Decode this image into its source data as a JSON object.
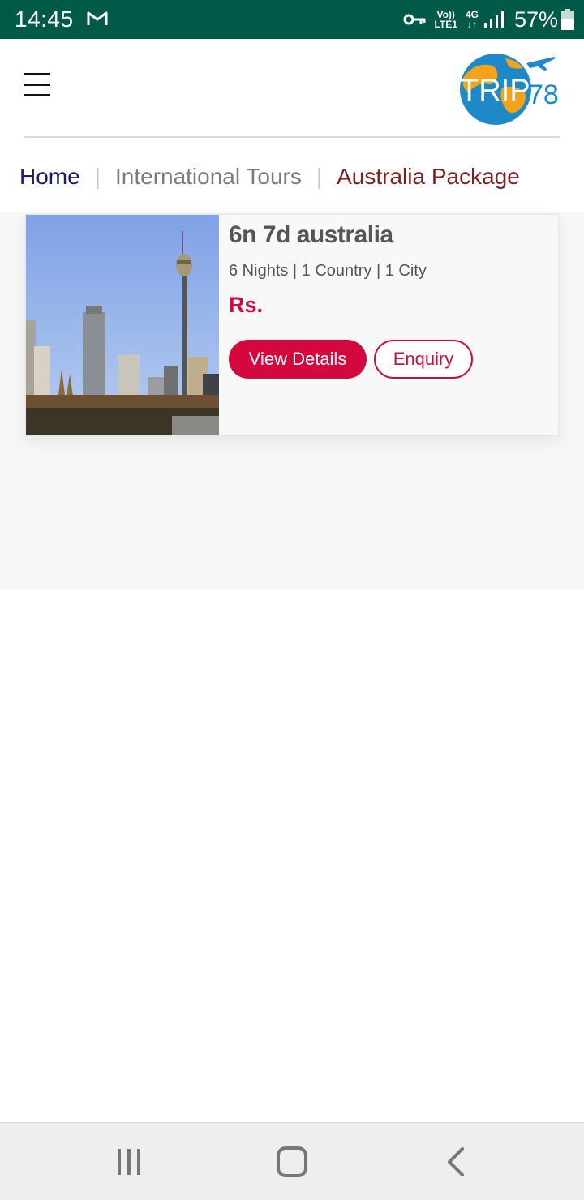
{
  "status_bar": {
    "time": "14:45",
    "volte_top": "Vo))",
    "volte_bottom": "LTE1",
    "network_top": "4G",
    "network_bottom": "↓↑",
    "battery_percent": "57%",
    "icons": [
      "gmail-icon",
      "vpn-key-icon",
      "signal-icon",
      "battery-icon"
    ]
  },
  "header": {
    "logo_text": "TRIP",
    "logo_number": "78",
    "menu_icon": "hamburger-menu-icon"
  },
  "breadcrumb": {
    "home": "Home",
    "separator": "|",
    "international": "International Tours",
    "current": "Australia Package"
  },
  "package_card": {
    "title": "6n 7d australia",
    "meta": "6 Nights | 1 Country | 1 City",
    "price": "Rs.",
    "view_details_label": "View Details",
    "enquiry_label": "Enquiry"
  },
  "nav_bar": {
    "icons": [
      "recent-apps-icon",
      "home-icon",
      "back-icon"
    ]
  },
  "colors": {
    "status_bar": "#005a47",
    "accent": "#d4083f",
    "breadcrumb_home": "#1a1a66",
    "breadcrumb_current": "#7a1f1f"
  }
}
